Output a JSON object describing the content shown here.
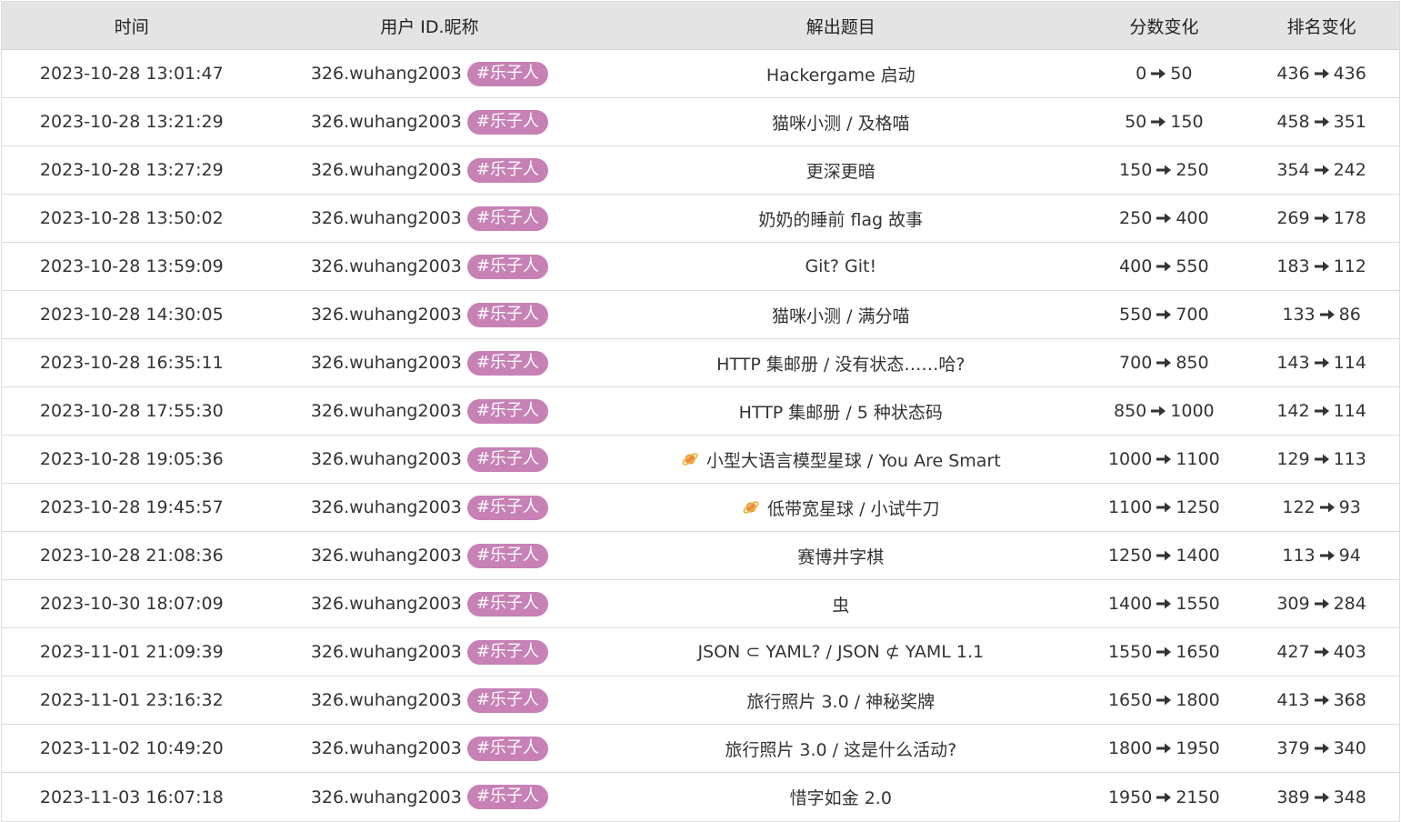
{
  "header": {
    "time": "时间",
    "user": "用户 ID.昵称",
    "problem": "解出题目",
    "score": "分数变化",
    "rank": "排名变化"
  },
  "colors": {
    "badge": "#c781b5",
    "header_bg": "#e4e4e4"
  },
  "rows": [
    {
      "time": "2023-10-28 13:01:47",
      "user": "326.wuhang2003",
      "tag": "#乐子人",
      "problem": "Hackergame 启动",
      "icon": "",
      "score_from": "0",
      "score_to": "50",
      "rank_from": "436",
      "rank_to": "436"
    },
    {
      "time": "2023-10-28 13:21:29",
      "user": "326.wuhang2003",
      "tag": "#乐子人",
      "problem": "猫咪小测 / 及格喵",
      "icon": "",
      "score_from": "50",
      "score_to": "150",
      "rank_from": "458",
      "rank_to": "351"
    },
    {
      "time": "2023-10-28 13:27:29",
      "user": "326.wuhang2003",
      "tag": "#乐子人",
      "problem": "更深更暗",
      "icon": "",
      "score_from": "150",
      "score_to": "250",
      "rank_from": "354",
      "rank_to": "242"
    },
    {
      "time": "2023-10-28 13:50:02",
      "user": "326.wuhang2003",
      "tag": "#乐子人",
      "problem": "奶奶的睡前 flag 故事",
      "icon": "",
      "score_from": "250",
      "score_to": "400",
      "rank_from": "269",
      "rank_to": "178"
    },
    {
      "time": "2023-10-28 13:59:09",
      "user": "326.wuhang2003",
      "tag": "#乐子人",
      "problem": "Git? Git!",
      "icon": "",
      "score_from": "400",
      "score_to": "550",
      "rank_from": "183",
      "rank_to": "112"
    },
    {
      "time": "2023-10-28 14:30:05",
      "user": "326.wuhang2003",
      "tag": "#乐子人",
      "problem": "猫咪小测 / 满分喵",
      "icon": "",
      "score_from": "550",
      "score_to": "700",
      "rank_from": "133",
      "rank_to": "86"
    },
    {
      "time": "2023-10-28 16:35:11",
      "user": "326.wuhang2003",
      "tag": "#乐子人",
      "problem": "HTTP 集邮册 / 没有状态……哈?",
      "icon": "",
      "score_from": "700",
      "score_to": "850",
      "rank_from": "143",
      "rank_to": "114"
    },
    {
      "time": "2023-10-28 17:55:30",
      "user": "326.wuhang2003",
      "tag": "#乐子人",
      "problem": "HTTP 集邮册 / 5 种状态码",
      "icon": "",
      "score_from": "850",
      "score_to": "1000",
      "rank_from": "142",
      "rank_to": "114"
    },
    {
      "time": "2023-10-28 19:05:36",
      "user": "326.wuhang2003",
      "tag": "#乐子人",
      "problem": "小型大语言模型星球 / You Are Smart",
      "icon": "planet-icon",
      "score_from": "1000",
      "score_to": "1100",
      "rank_from": "129",
      "rank_to": "113"
    },
    {
      "time": "2023-10-28 19:45:57",
      "user": "326.wuhang2003",
      "tag": "#乐子人",
      "problem": "低带宽星球 / 小试牛刀",
      "icon": "planet-icon",
      "score_from": "1100",
      "score_to": "1250",
      "rank_from": "122",
      "rank_to": "93"
    },
    {
      "time": "2023-10-28 21:08:36",
      "user": "326.wuhang2003",
      "tag": "#乐子人",
      "problem": "赛博井字棋",
      "icon": "",
      "score_from": "1250",
      "score_to": "1400",
      "rank_from": "113",
      "rank_to": "94"
    },
    {
      "time": "2023-10-30 18:07:09",
      "user": "326.wuhang2003",
      "tag": "#乐子人",
      "problem": "虫",
      "icon": "",
      "score_from": "1400",
      "score_to": "1550",
      "rank_from": "309",
      "rank_to": "284"
    },
    {
      "time": "2023-11-01 21:09:39",
      "user": "326.wuhang2003",
      "tag": "#乐子人",
      "problem": "JSON ⊂ YAML? / JSON ⊄ YAML 1.1",
      "icon": "",
      "score_from": "1550",
      "score_to": "1650",
      "rank_from": "427",
      "rank_to": "403"
    },
    {
      "time": "2023-11-01 23:16:32",
      "user": "326.wuhang2003",
      "tag": "#乐子人",
      "problem": "旅行照片 3.0 / 神秘奖牌",
      "icon": "",
      "score_from": "1650",
      "score_to": "1800",
      "rank_from": "413",
      "rank_to": "368"
    },
    {
      "time": "2023-11-02 10:49:20",
      "user": "326.wuhang2003",
      "tag": "#乐子人",
      "problem": "旅行照片 3.0 / 这是什么活动?",
      "icon": "",
      "score_from": "1800",
      "score_to": "1950",
      "rank_from": "379",
      "rank_to": "340"
    },
    {
      "time": "2023-11-03 16:07:18",
      "user": "326.wuhang2003",
      "tag": "#乐子人",
      "problem": "惜字如金 2.0",
      "icon": "",
      "score_from": "1950",
      "score_to": "2150",
      "rank_from": "389",
      "rank_to": "348"
    }
  ]
}
